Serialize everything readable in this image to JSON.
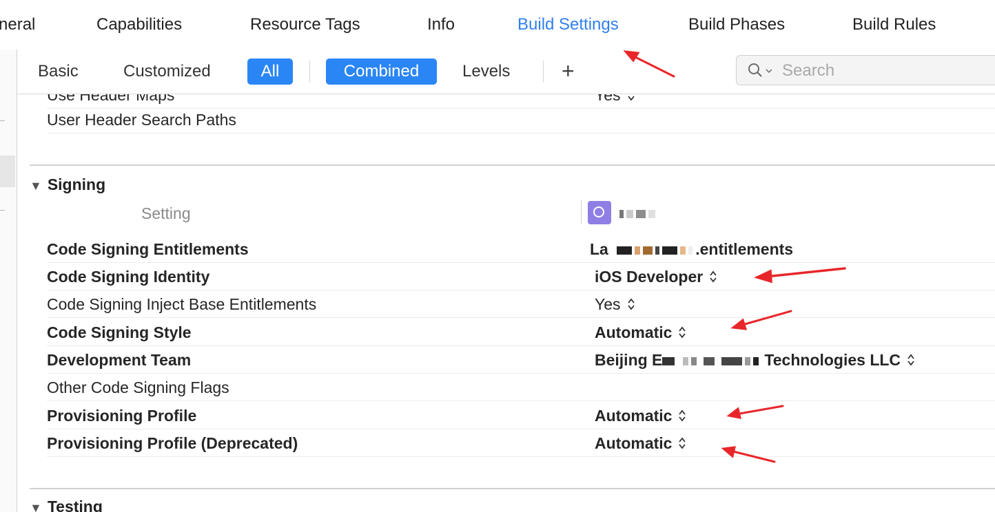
{
  "tabs": [
    {
      "label": "neral"
    },
    {
      "label": "Capabilities"
    },
    {
      "label": "Resource Tags"
    },
    {
      "label": "Info"
    },
    {
      "label": "Build Settings"
    },
    {
      "label": "Build Phases"
    },
    {
      "label": "Build Rules"
    }
  ],
  "active_tab_color": "#2f7ff0",
  "filter": {
    "basic": "Basic",
    "customized": "Customized",
    "all": "All",
    "combined": "Combined",
    "levels": "Levels",
    "add": "+",
    "search_placeholder": "Search",
    "pill_color": "#2b86f5"
  },
  "partial_rows": [
    {
      "name": "Use Header Maps",
      "value": "Yes"
    },
    {
      "name": "User Header Search Paths",
      "value": ""
    }
  ],
  "signing": {
    "title": "Signing",
    "column_header": "Setting",
    "rows": [
      {
        "name": "Code Signing Entitlements",
        "value_prefix": "La",
        "value_suffix": ".entitlements"
      },
      {
        "name": "Code Signing Identity",
        "value": "iOS Developer"
      },
      {
        "name": "Code Signing Inject Base Entitlements",
        "value": "Yes"
      },
      {
        "name": "Code Signing Style",
        "value": "Automatic"
      },
      {
        "name": "Development Team",
        "value_prefix": "Beijing E",
        "value_suffix": "Technologies LLC"
      },
      {
        "name": "Other Code Signing Flags",
        "value": ""
      },
      {
        "name": "Provisioning Profile",
        "value": "Automatic"
      },
      {
        "name": "Provisioning Profile (Deprecated)",
        "value": "Automatic"
      }
    ]
  },
  "testing": {
    "title": "Testing"
  },
  "annotation_color": "#e8262a"
}
